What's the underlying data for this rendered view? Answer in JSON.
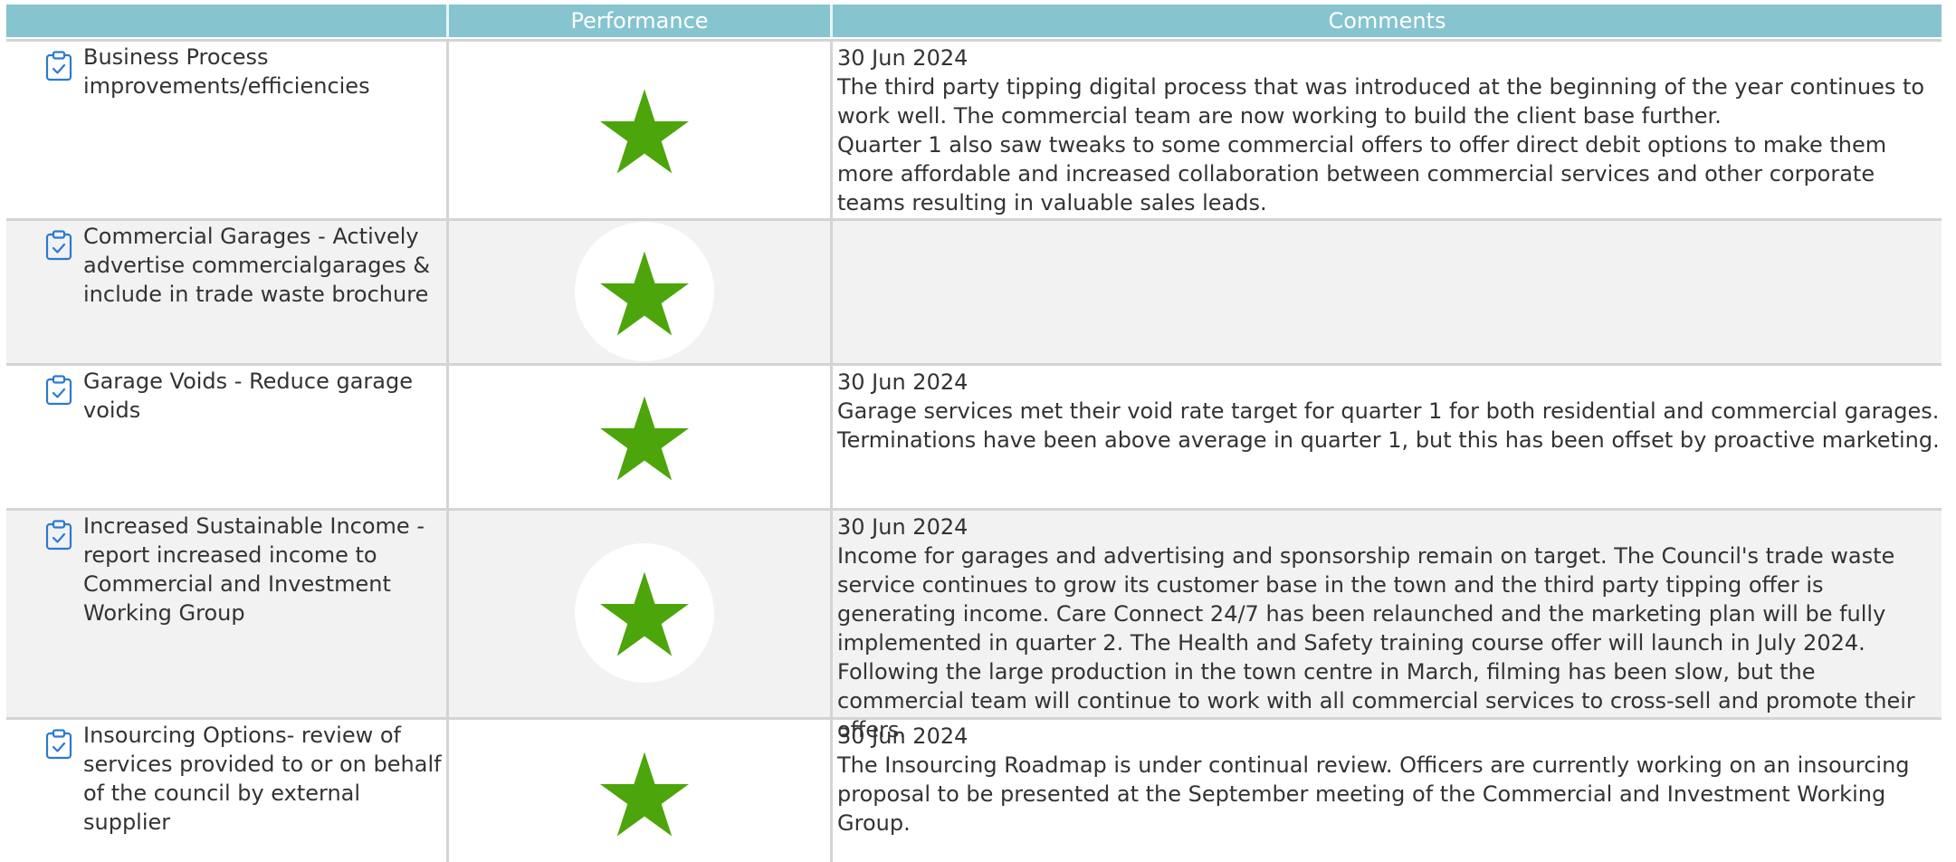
{
  "header": {
    "performance_label": "Performance",
    "comments_label": "Comments"
  },
  "colors": {
    "header_bg": "#86c4cf",
    "star": "#4ca50a",
    "icon": "#2b7ad0",
    "alt_row": "#f2f2f2"
  },
  "rows": [
    {
      "name": "Business Process improvements/efficiencies",
      "icon": "clipboard-check-icon",
      "performance": "star",
      "comment_date": "30 Jun 2024",
      "comment_lines": [
        "The third party tipping digital process that was introduced at the beginning of the year continues to work well. The commercial team are now working to build the client base further.",
        "Quarter 1 also saw tweaks to some commercial offers to offer direct debit options to make them more affordable and increased collaboration between commercial services and other corporate teams resulting in valuable sales leads."
      ]
    },
    {
      "name": "Commercial Garages - Actively advertise commercialgarages & include in trade waste brochure",
      "icon": "clipboard-check-icon",
      "performance": "star",
      "comment_date": "",
      "comment_lines": []
    },
    {
      "name": "Garage Voids - Reduce garage voids",
      "icon": "clipboard-check-icon",
      "performance": "star",
      "comment_date": "30 Jun 2024",
      "comment_lines": [
        "Garage services met their void rate target for quarter 1 for both residential and commercial garages.",
        "Terminations have been above average in quarter 1, but this has been offset by proactive marketing."
      ]
    },
    {
      "name": "Increased Sustainable Income - report increased income to Commercial and Investment Working Group",
      "icon": "clipboard-check-icon",
      "performance": "star",
      "comment_date": "30 Jun 2024",
      "comment_lines": [
        "Income for garages and advertising and sponsorship remain on target. The Council's trade waste service continues to grow its customer base in the town and the third party tipping offer is generating income. Care Connect 24/7 has been relaunched and the marketing plan will be fully implemented in quarter 2. The Health and Safety training course offer will launch in July 2024. Following the large production in the town centre in March, filming has been slow, but the commercial team will continue to work with all commercial services to cross-sell and promote their offers."
      ]
    },
    {
      "name": "Insourcing Options- review of services provided to or on behalf of the council by external supplier",
      "icon": "clipboard-check-icon",
      "performance": "star",
      "comment_date": "30 Jun 2024",
      "comment_lines": [
        "The Insourcing Roadmap is under continual review. Officers are currently working on an insourcing proposal to be presented at the September meeting of the Commercial and Investment Working Group."
      ]
    }
  ]
}
